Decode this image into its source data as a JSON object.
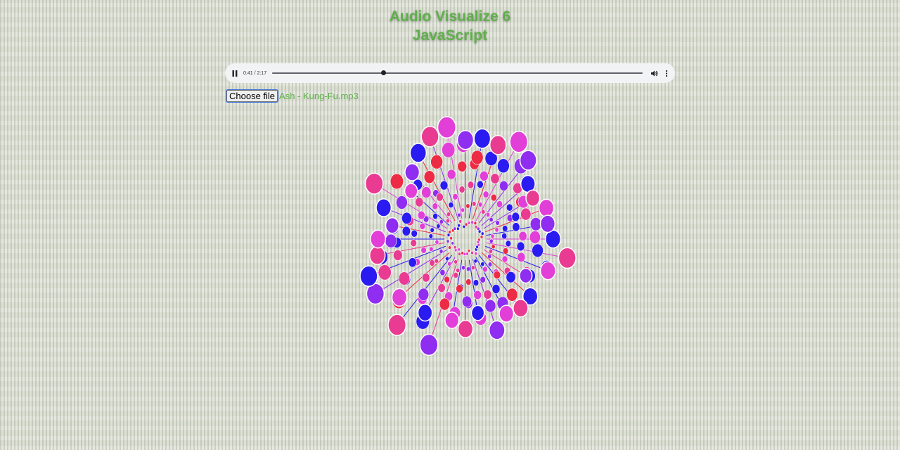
{
  "title": {
    "line1": "Audio Visualize 6",
    "line2": "JavaScript"
  },
  "player": {
    "current_time": "0:41",
    "duration": "2:17",
    "time_display": "0:41 / 2:17",
    "progress_fraction": 0.3,
    "state": "playing",
    "icons": {
      "play": "pause-icon",
      "volume": "volume-icon",
      "more": "more-options-icon"
    }
  },
  "file_input": {
    "button_label": "Choose file",
    "file_name": "Ash - Kung-Fu.mp3"
  },
  "colors": {
    "accent_green": "#5fb04a",
    "dot_blue": "#2a1cf0",
    "dot_violet": "#8f2df0",
    "dot_magenta": "#e23fd8",
    "dot_pink": "#ea3b92",
    "dot_red": "#ee2b44"
  }
}
